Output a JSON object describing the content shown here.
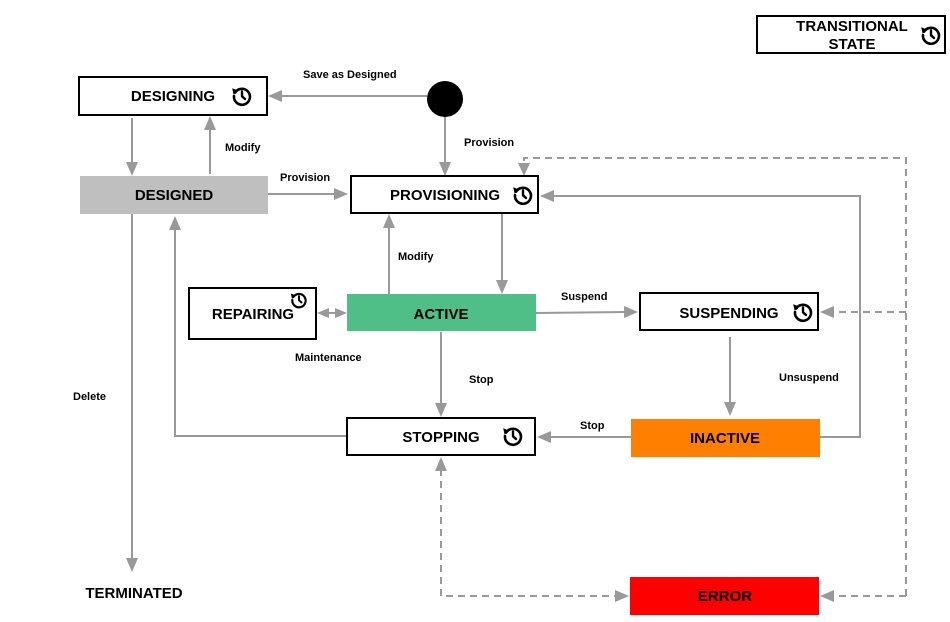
{
  "legend": {
    "line1": "TRANSITIONAL",
    "line2": "STATE",
    "icon": "history-icon"
  },
  "states": {
    "designing": {
      "label": "DESIGNING",
      "transitional": true
    },
    "designed": {
      "label": "DESIGNED",
      "color": "#BFBFBF"
    },
    "provisioning": {
      "label": "PROVISIONING",
      "transitional": true
    },
    "repairing": {
      "label": "REPAIRING",
      "transitional": true
    },
    "active": {
      "label": "ACTIVE",
      "color": "#4FBF87"
    },
    "suspending": {
      "label": "SUSPENDING",
      "transitional": true
    },
    "stopping": {
      "label": "STOPPING",
      "transitional": true
    },
    "inactive": {
      "label": "INACTIVE",
      "color": "#FF7F00"
    },
    "error": {
      "label": "ERROR",
      "color": "#FF0000"
    },
    "terminated": {
      "label": "TERMINATED"
    }
  },
  "transitions": {
    "save_as_designed": "Save as Designed",
    "provision_initial": "Provision",
    "modify_designed": "Modify",
    "provision_designed": "Provision",
    "modify_active": "Modify",
    "maintenance": "Maintenance",
    "suspend": "Suspend",
    "stop_active": "Stop",
    "unsuspend": "Unsuspend",
    "stop_inactive": "Stop",
    "delete": "Delete"
  },
  "colors": {
    "connector": "#999999",
    "border": "#000000"
  }
}
